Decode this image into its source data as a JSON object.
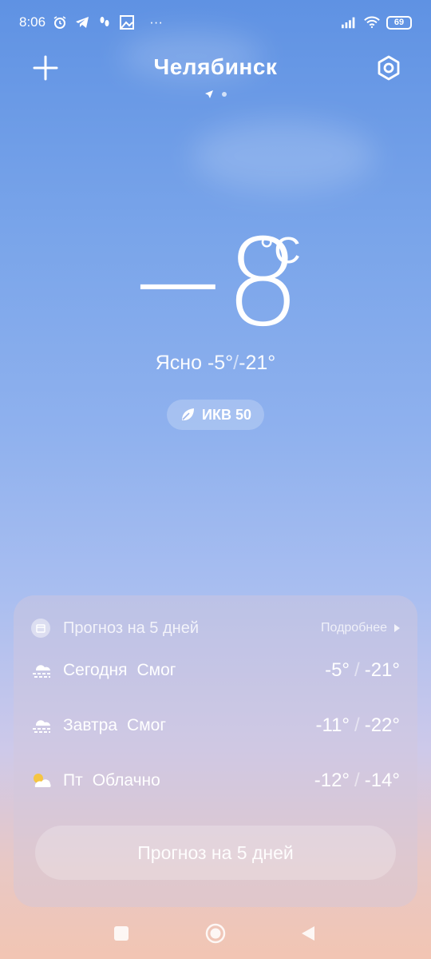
{
  "status_bar": {
    "time": "8:06",
    "left_icons": [
      "alarm-icon",
      "telegram-icon",
      "footprints-icon",
      "photo-icon",
      "more-dots-icon"
    ],
    "more": "···",
    "right_icons": [
      "signal-icon",
      "wifi-icon"
    ],
    "battery": "69"
  },
  "header": {
    "city": "Челябинск",
    "add_icon": "plus-icon",
    "settings_icon": "settings-hex-icon"
  },
  "current": {
    "temperature": "−8",
    "unit": "°C",
    "condition": "Ясно",
    "high": "-5°",
    "separator": "/",
    "low": "-21°",
    "aqi_label": "ИКВ 50"
  },
  "forecast": {
    "title": "Прогноз на 5 дней",
    "more_label": "Подробнее",
    "rows": [
      {
        "day": "Сегодня",
        "condition": "Смог",
        "high": "-5°",
        "low": "-21°",
        "icon": "fog-icon"
      },
      {
        "day": "Завтра",
        "condition": "Смог",
        "high": "-11°",
        "low": "-22°",
        "icon": "fog-icon"
      },
      {
        "day": "Пт",
        "condition": "Облачно",
        "high": "-12°",
        "low": "-14°",
        "icon": "partly-cloudy-icon"
      }
    ],
    "separator": "/",
    "button_label": "Прогноз на 5 дней"
  },
  "colors": {
    "sky_top": "#5f92e3",
    "sky_bottom": "#f2c5b3",
    "sun": "#f5c542"
  }
}
